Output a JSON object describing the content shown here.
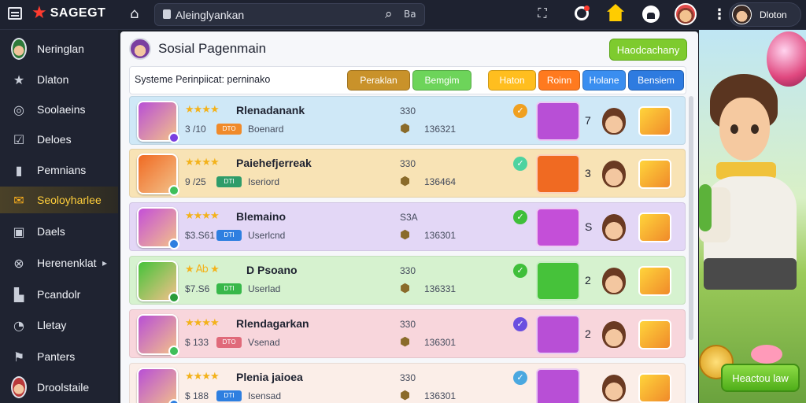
{
  "app": {
    "logo_text": "SAGEGT"
  },
  "topbar": {
    "search_value": "Aleinglyankan",
    "search_shortcut": "Ba",
    "user_name": "Dloton"
  },
  "sidebar": {
    "items": [
      {
        "label": "Neringlan",
        "icon": "avatar-icon"
      },
      {
        "label": "Dlaton",
        "icon": "star-icon"
      },
      {
        "label": "Soolaeins",
        "icon": "ring-icon"
      },
      {
        "label": "Deloes",
        "icon": "check-icon"
      },
      {
        "label": "Pemnians",
        "icon": "document-icon"
      },
      {
        "label": "Seoloyharlee",
        "icon": "mail-icon",
        "active": true
      },
      {
        "label": "Daels",
        "icon": "screen-icon"
      },
      {
        "label": "Herenenklat",
        "icon": "close-circle-icon",
        "has_submenu": true
      },
      {
        "label": "Pcandolr",
        "icon": "building-icon"
      },
      {
        "label": "Lletay",
        "icon": "clock-icon"
      },
      {
        "label": "Panters",
        "icon": "flag-icon"
      },
      {
        "label": "Droolstaile",
        "icon": "avatar-icon"
      }
    ]
  },
  "page": {
    "title": "Sosial Pagenmain",
    "top_button": "Haodcachany"
  },
  "filterbar": {
    "text": "Systeme Perinpiicat: perninako",
    "buttons": [
      "Peraklan",
      "Bemgim",
      "Haton",
      "Roinn",
      "Holane",
      "Bensiem"
    ]
  },
  "rows": [
    {
      "title": "Rlenadanank",
      "meta": "3 /10",
      "badge": "DTO",
      "sub": "Boenard",
      "n1": "330",
      "n2": "136321",
      "card_count": "7",
      "stars": "★★★★",
      "colors": {
        "bg": "#cfe8f7",
        "card": "#b84fd6",
        "dot": "#7b3fe0",
        "status": "#f0a020",
        "badge": "#f08a2a"
      }
    },
    {
      "title": "Paiehefjerreak",
      "meta": "9 /25",
      "badge": "DTI",
      "sub": "Iseriord",
      "n1": "330",
      "n2": "136464",
      "card_count": "3",
      "stars": "★★★★",
      "colors": {
        "bg": "#f8e3b5",
        "card": "#f06a22",
        "dot": "#3fbf5a",
        "status": "#4ed3a0",
        "badge": "#2f9c6a"
      }
    },
    {
      "title": "Blemaino",
      "meta": "$3.S61",
      "badge": "DTI",
      "sub": "Userlcnd",
      "n1": "S3A",
      "n2": "136301",
      "card_count": "S",
      "stars": "★★★★",
      "colors": {
        "bg": "#e3d7f6",
        "card": "#c44fd8",
        "dot": "#2e7fe0",
        "status": "#3fbf3a",
        "badge": "#2e7fe0"
      }
    },
    {
      "title": "D Psoano",
      "meta": "$7.S6",
      "badge": "DTI",
      "sub": "Userlad",
      "n1": "330",
      "n2": "136331",
      "card_count": "2",
      "stars": "★ Ab ★",
      "colors": {
        "bg": "#d6f2cf",
        "card": "#46c23a",
        "dot": "#2a9c3a",
        "status": "#3fbf3a",
        "badge": "#38b84a"
      }
    },
    {
      "title": "Rlendagarkan",
      "meta": "$ 133",
      "badge": "DTO",
      "sub": "Vsenad",
      "n1": "330",
      "n2": "136301",
      "card_count": "2",
      "stars": "★★★★",
      "colors": {
        "bg": "#f8d6dc",
        "card": "#b84fd6",
        "dot": "#3fbf5a",
        "status": "#6a4fe0",
        "badge": "#e06a7a"
      }
    },
    {
      "title": "Plenia jaioea",
      "meta": "$ 188",
      "badge": "DTI",
      "sub": "Isensad",
      "n1": "330",
      "n2": "136301",
      "card_count": "",
      "stars": "★★★★",
      "colors": {
        "bg": "#fbeee8",
        "card": "#b84fd6",
        "dot": "#2e7fe0",
        "status": "#4aa8e0",
        "badge": "#2e7fe0"
      }
    }
  ],
  "art": {
    "cta_button": "Heactou law"
  },
  "colors": {
    "topbar_bg": "#1e2230",
    "sidebar_bg": "#1f2331",
    "accent_yellow": "#ffce3b",
    "accent_green": "#7ecb2e"
  }
}
